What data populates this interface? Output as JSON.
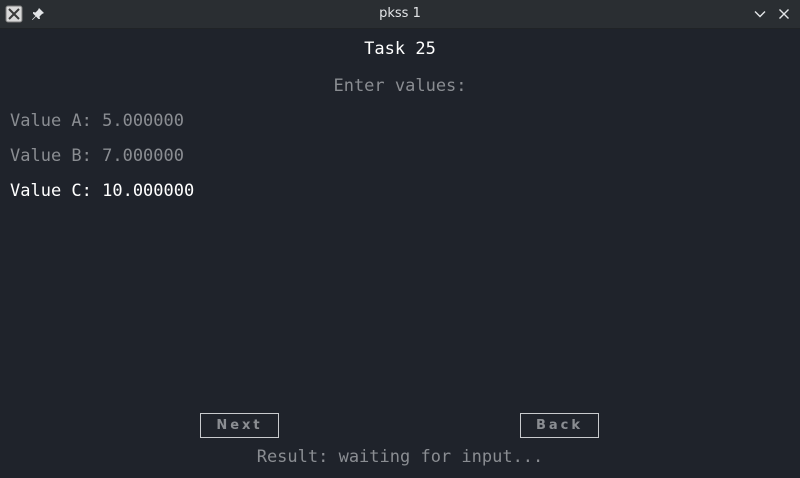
{
  "window": {
    "title": "pkss 1"
  },
  "icons": {
    "app": "x-app-icon",
    "pin": "pin-icon",
    "minimize": "chevron-down-icon",
    "close": "close-icon"
  },
  "main": {
    "task_title": "Task 25",
    "prompt": "Enter values:",
    "values": [
      {
        "text": "Value A: 5.000000"
      },
      {
        "text": "Value B: 7.000000"
      },
      {
        "text": "Value C: 10.000000"
      }
    ],
    "next_label": "Next",
    "back_label": "Back",
    "result": "Result: waiting for input..."
  },
  "colors": {
    "background": "#1f232b",
    "titlebar": "#2a2e32",
    "active_text": "#ffffff",
    "inactive_text": "#8a8d92"
  }
}
